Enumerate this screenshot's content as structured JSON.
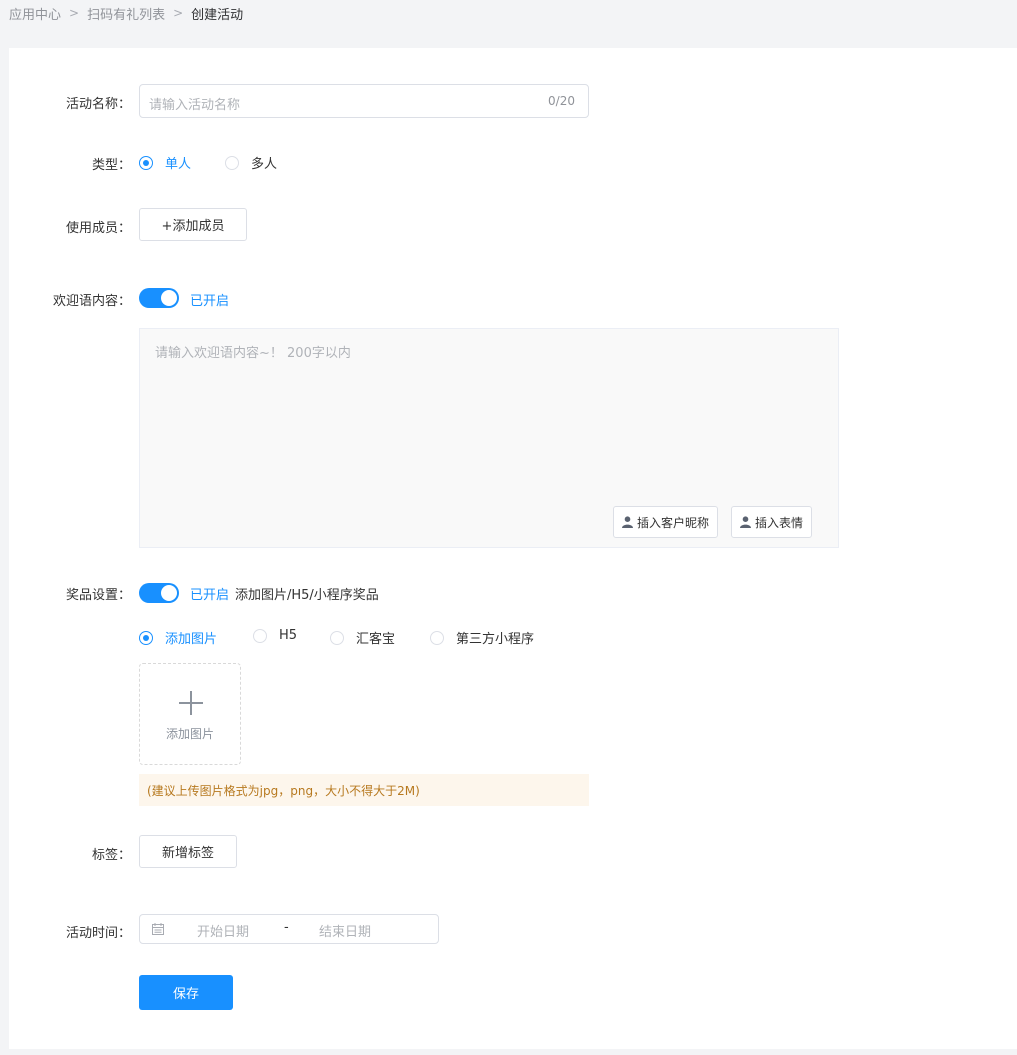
{
  "breadcrumb": {
    "items": [
      "应用中心",
      "扫码有礼列表",
      "创建活动"
    ],
    "separator": ">"
  },
  "form": {
    "name": {
      "label": "活动名称：",
      "placeholder": "请输入活动名称",
      "counter": "0/20"
    },
    "type": {
      "label": "类型：",
      "options": [
        "单人",
        "多人"
      ],
      "selected": "单人"
    },
    "members": {
      "label": "使用成员：",
      "button": "+添加成员"
    },
    "welcome": {
      "label": "欢迎语内容：",
      "switch_text": "已开启",
      "enabled": true,
      "placeholder": "请输入欢迎语内容~！ 200字以内",
      "insert_nickname": "插入客户昵称",
      "insert_emoji": "插入表情"
    },
    "prize": {
      "label": "奖品设置：",
      "switch_text": "已开启",
      "enabled": true,
      "desc": "添加图片/H5/小程序奖品",
      "options": [
        "添加图片",
        "H5",
        "汇客宝",
        "第三方小程序"
      ],
      "selected": "添加图片",
      "upload_text": "添加图片",
      "hint": "(建议上传图片格式为jpg，png，大小不得大于2M)"
    },
    "tags": {
      "label": "标签：",
      "button": "新增标签"
    },
    "time": {
      "label": "活动时间：",
      "start_placeholder": "开始日期",
      "separator": "-",
      "end_placeholder": "结束日期"
    },
    "save": "保存"
  },
  "icons": [
    "chevron-right-icon",
    "user-icon",
    "plus-icon",
    "calendar-icon"
  ],
  "colors": {
    "primary": "#1890ff",
    "hint_bg": "#fdf6ec",
    "hint_text": "#b7791f"
  }
}
